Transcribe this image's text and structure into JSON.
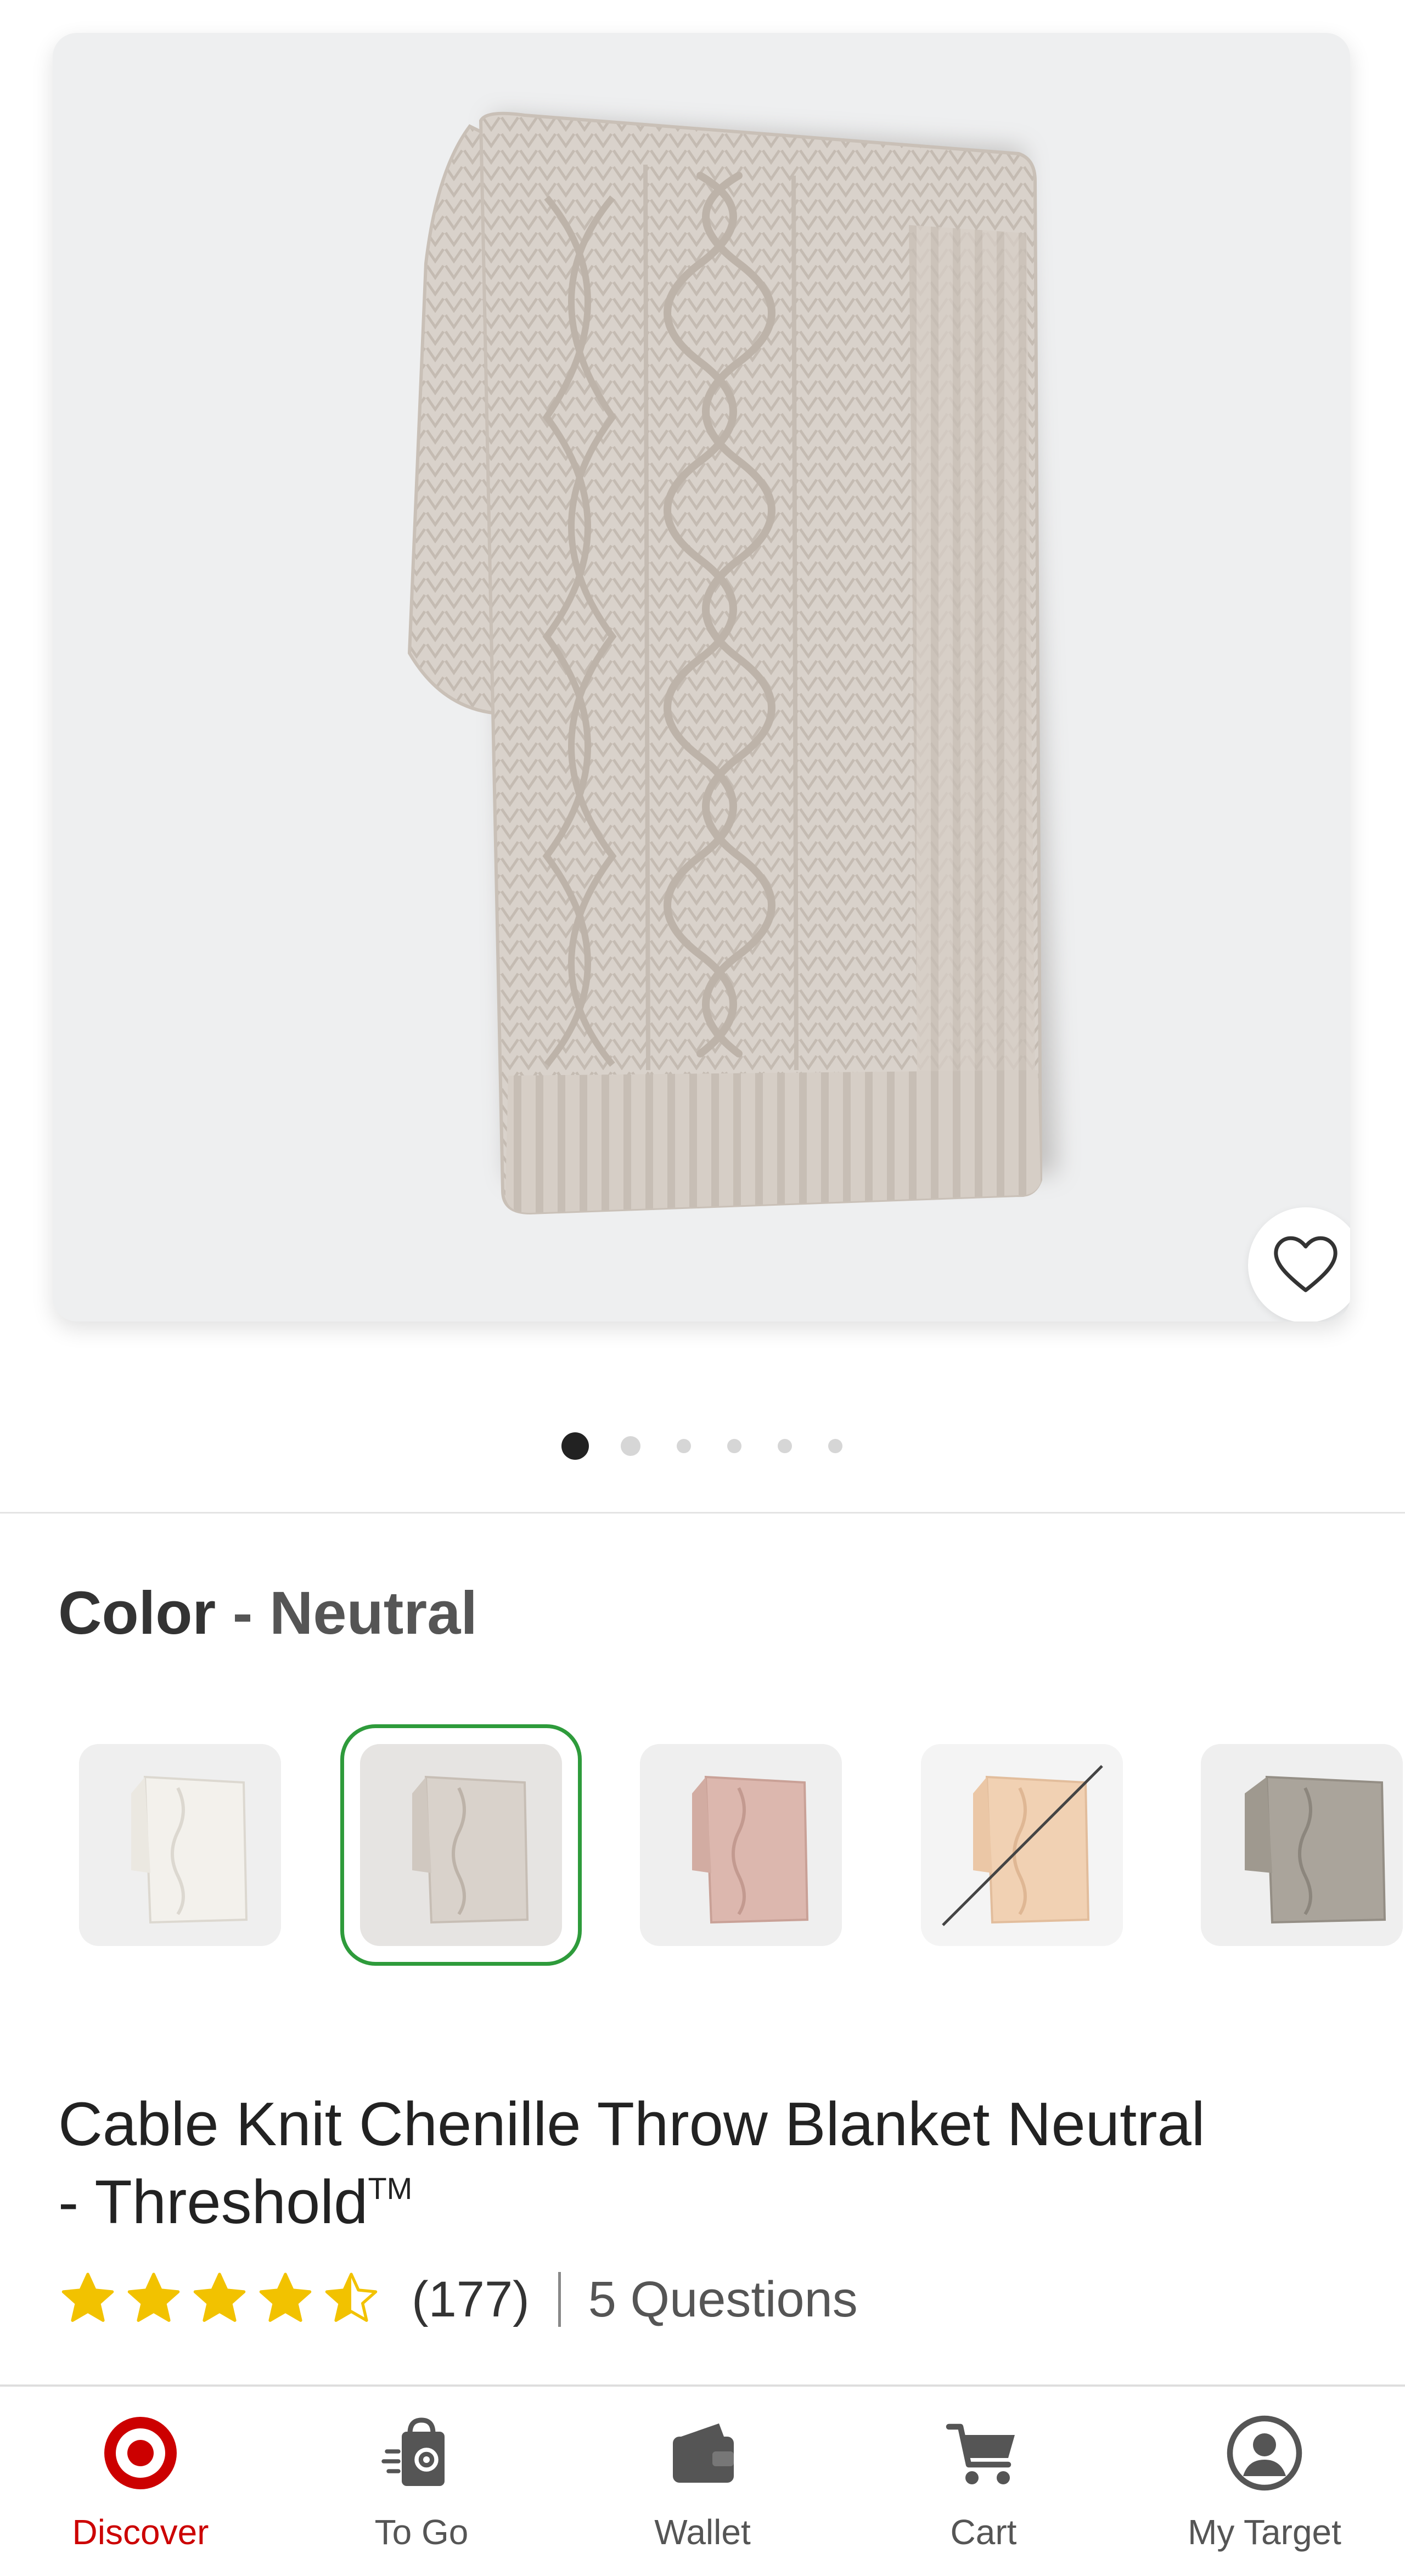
{
  "product_image": {
    "alt": "Cable Knit Chenille Throw Blanket Neutral",
    "favorite_icon": "heart-outline-icon"
  },
  "carousel": {
    "total_images": 6,
    "active_index": 1
  },
  "color": {
    "label": "Color",
    "separator": "-",
    "selected": "Neutral",
    "swatches": [
      {
        "name": "White",
        "color": "#f3f1ec",
        "selected": false,
        "available": true
      },
      {
        "name": "Neutral",
        "color": "#d9d2cb",
        "selected": true,
        "available": true
      },
      {
        "name": "Pink",
        "color": "#dcb7ae",
        "selected": false,
        "available": true
      },
      {
        "name": "Peach",
        "color": "#f1d1b3",
        "selected": false,
        "available": false
      },
      {
        "name": "Gray",
        "color": "#aaa49b",
        "selected": false,
        "available": true
      }
    ],
    "selected_ring_color": "#2e9b3b"
  },
  "product": {
    "title_line1": "Cable Knit Chenille Throw Blanket Neutral",
    "title_line2": "- Threshold",
    "trademark": "TM"
  },
  "rating": {
    "value": 4.5,
    "max": 5,
    "count": "(177)",
    "questions": "5 Questions",
    "star_color": "#f2c200"
  },
  "tabbar": {
    "accent_color": "#cc0000",
    "active": "Discover",
    "tabs": [
      {
        "label": "Discover",
        "icon": "target-bullseye-icon"
      },
      {
        "label": "To Go",
        "icon": "shopping-bag-icon"
      },
      {
        "label": "Wallet",
        "icon": "wallet-icon"
      },
      {
        "label": "Cart",
        "icon": "cart-icon"
      },
      {
        "label": "My Target",
        "icon": "account-icon"
      }
    ]
  }
}
